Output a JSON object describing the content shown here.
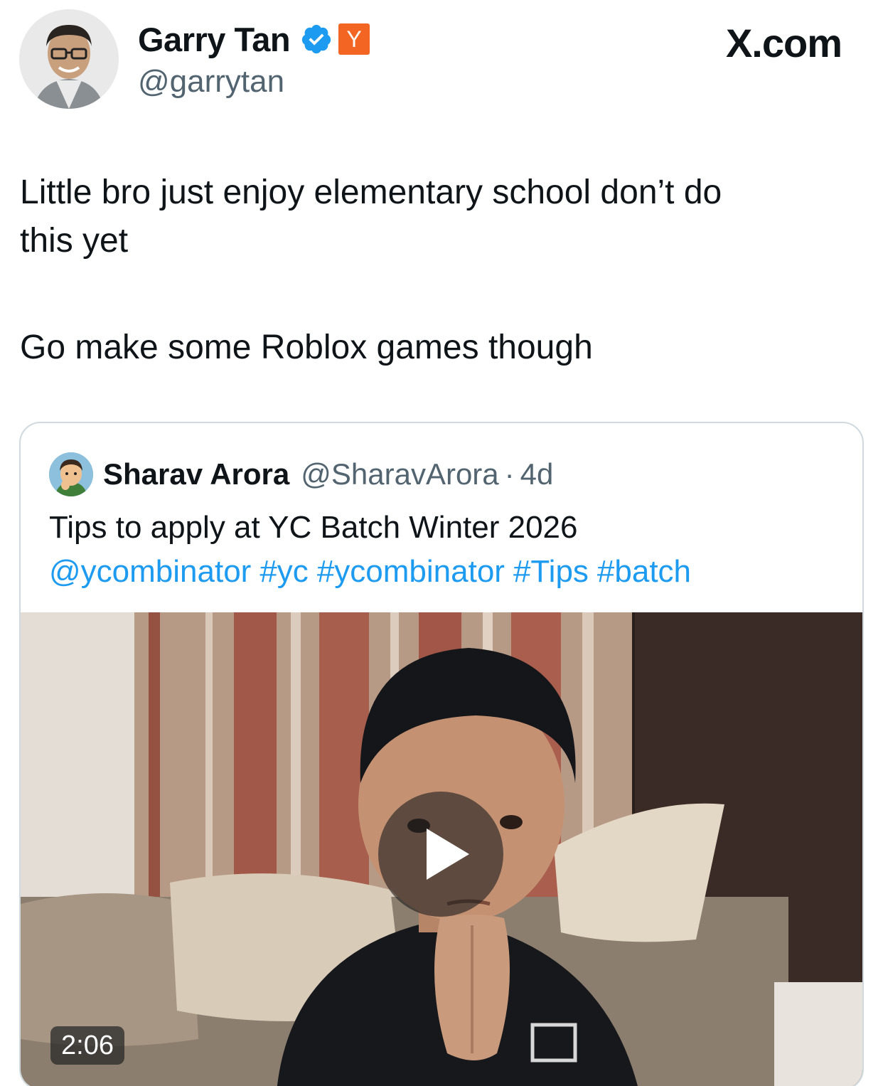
{
  "author": {
    "name": "Garry Tan",
    "handle": "@garrytan",
    "badge_label": "Y",
    "verified_icon": "verified-badge-icon",
    "verified_color": "#1d9bf0",
    "badge_color": "#f26522"
  },
  "site_label": "X.com",
  "tweet": {
    "line1": "Little bro just enjoy elementary school don’t do",
    "line2": "this yet",
    "line3": "Go make some Roblox games though"
  },
  "quote": {
    "name": "Sharav Arora",
    "handle": "@SharavArora",
    "separator": "·",
    "time": "4d",
    "text": "Tips to apply at YC Batch Winter 2026",
    "links": [
      "@ycombinator",
      "#yc",
      "#ycombinator",
      "#Tips",
      "#batch"
    ],
    "link_color": "#1d9bf0"
  },
  "video": {
    "duration": "2:06",
    "play_icon": "play-icon"
  }
}
